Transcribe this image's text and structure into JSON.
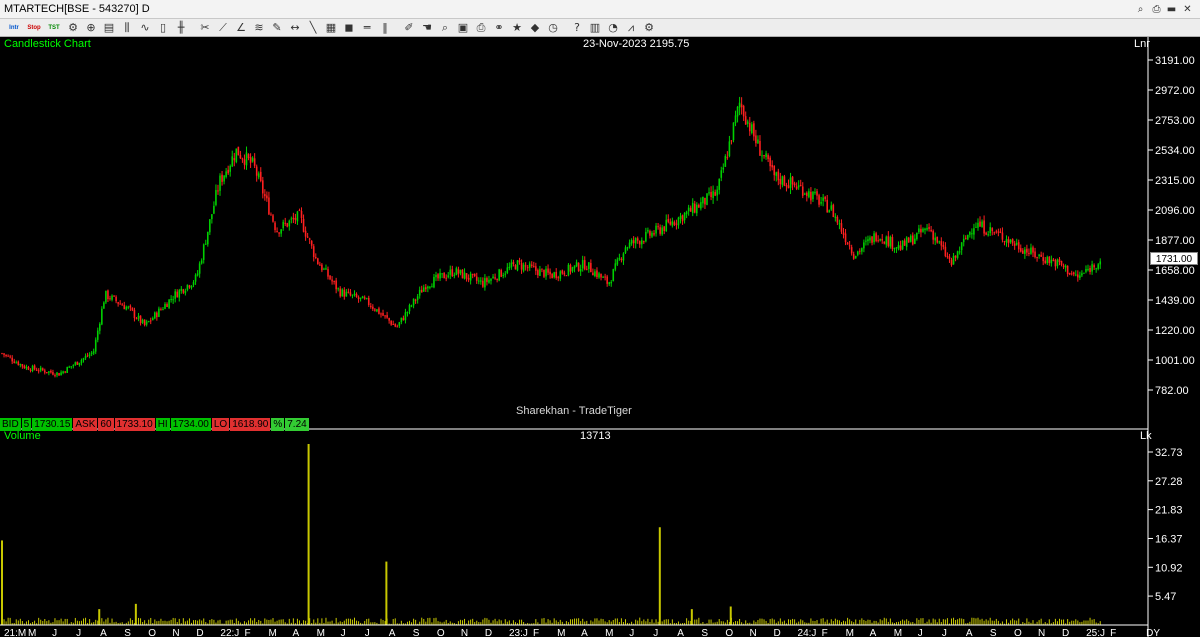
{
  "window": {
    "title": "MTARTECH[BSE - 543270] D"
  },
  "toolbar": {
    "items": [
      {
        "name": "intraday-icon",
        "glyph": "Intr"
      },
      {
        "name": "stop-icon",
        "glyph": "Stop"
      },
      {
        "name": "tst-icon",
        "glyph": "TST"
      },
      {
        "name": "settings-icon",
        "glyph": "⚙"
      },
      {
        "name": "crosshair-icon",
        "glyph": "⊕"
      },
      {
        "name": "chart-type-icon",
        "glyph": "▤"
      },
      {
        "name": "bars-icon",
        "glyph": "⫼"
      },
      {
        "name": "line-chart-icon",
        "glyph": "∿"
      },
      {
        "name": "candle-icon",
        "glyph": "▯"
      },
      {
        "name": "ohlc-icon",
        "glyph": "╫"
      },
      {
        "name": "scissors-icon",
        "glyph": "✂"
      },
      {
        "name": "trendline-icon",
        "glyph": "⟋"
      },
      {
        "name": "angle-icon",
        "glyph": "∠"
      },
      {
        "name": "fib-icon",
        "glyph": "≋"
      },
      {
        "name": "pencil-icon",
        "glyph": "✎"
      },
      {
        "name": "arrow-both-icon",
        "glyph": "↔"
      },
      {
        "name": "line-icon",
        "glyph": "╲"
      },
      {
        "name": "grid-icon",
        "glyph": "▦"
      },
      {
        "name": "cube-icon",
        "glyph": "◼"
      },
      {
        "name": "hline-icon",
        "glyph": "═"
      },
      {
        "name": "vlines-icon",
        "glyph": "‖"
      },
      {
        "name": "pen-icon",
        "glyph": "✐"
      },
      {
        "name": "hand-icon",
        "glyph": "☚"
      },
      {
        "name": "zoom-icon",
        "glyph": "⌕"
      },
      {
        "name": "document-icon",
        "glyph": "▣"
      },
      {
        "name": "print-icon",
        "glyph": "⎙"
      },
      {
        "name": "link-icon",
        "glyph": "⚭"
      },
      {
        "name": "star-icon",
        "glyph": "★"
      },
      {
        "name": "tag-icon",
        "glyph": "◆"
      },
      {
        "name": "clock-icon",
        "glyph": "◷"
      },
      {
        "name": "help-icon",
        "glyph": "?"
      },
      {
        "name": "trash-icon",
        "glyph": "▥"
      },
      {
        "name": "pie-icon",
        "glyph": "◔"
      },
      {
        "name": "graph-icon",
        "glyph": "⩘"
      },
      {
        "name": "gear-icon",
        "glyph": "⚙"
      }
    ]
  },
  "price_panel": {
    "label": "Candlestick Chart",
    "readout": "23-Nov-2023 2195.75",
    "scale": "Lnr",
    "watermark": "Sharekhan - TradeTiger",
    "last_price": "1731.00",
    "y_ticks": [
      "3191.00",
      "2972.00",
      "2753.00",
      "2534.00",
      "2315.00",
      "2096.00",
      "1877.00",
      "1658.00",
      "1439.00",
      "1220.00",
      "1001.00",
      "782.00"
    ]
  },
  "quote": {
    "bid_label": "BID",
    "bid_qty": "5",
    "bid": "1730.15",
    "ask_label": "ASK",
    "ask_qty": "60",
    "ask": "1733.10",
    "hi_label": "HI",
    "hi": "1734.00",
    "lo_label": "LO",
    "lo": "1618.90",
    "pct_label": "%",
    "pct": "7.24"
  },
  "volume_panel": {
    "label": "Volume",
    "readout": "13713",
    "unit": "Lk",
    "y_ticks": [
      "32.73",
      "27.28",
      "21.83",
      "16.37",
      "10.92",
      "5.47"
    ]
  },
  "x_axis": {
    "labels": [
      "21:M",
      "M",
      "J",
      "J",
      "A",
      "S",
      "O",
      "N",
      "D",
      "22:J",
      "F",
      "M",
      "A",
      "M",
      "J",
      "J",
      "A",
      "S",
      "O",
      "N",
      "D",
      "23:J",
      "F",
      "M",
      "A",
      "M",
      "J",
      "J",
      "A",
      "S",
      "O",
      "N",
      "D",
      "24:J",
      "F",
      "M",
      "A",
      "M",
      "J",
      "J",
      "A",
      "S",
      "O",
      "N",
      "D",
      "25:J",
      "F",
      "DY"
    ]
  },
  "colors": {
    "up": "#00d000",
    "down": "#ff2020",
    "volume": "#c8c800",
    "background": "#000000"
  },
  "chart_data": {
    "type": "candlestick",
    "symbol": "MTARTECH[BSE - 543270] D",
    "title": "Candlestick Chart",
    "ylim": [
      782,
      3191
    ],
    "volume_ylim": [
      0,
      32.73
    ],
    "anchor_closes": [
      {
        "t": 0.0,
        "v": 1050
      },
      {
        "t": 0.02,
        "v": 950
      },
      {
        "t": 0.05,
        "v": 900
      },
      {
        "t": 0.08,
        "v": 1060
      },
      {
        "t": 0.09,
        "v": 1480
      },
      {
        "t": 0.11,
        "v": 1380
      },
      {
        "t": 0.125,
        "v": 1250
      },
      {
        "t": 0.15,
        "v": 1470
      },
      {
        "t": 0.17,
        "v": 1600
      },
      {
        "t": 0.19,
        "v": 2300
      },
      {
        "t": 0.205,
        "v": 2530
      },
      {
        "t": 0.22,
        "v": 2420
      },
      {
        "t": 0.24,
        "v": 1950
      },
      {
        "t": 0.26,
        "v": 2050
      },
      {
        "t": 0.275,
        "v": 1730
      },
      {
        "t": 0.295,
        "v": 1500
      },
      {
        "t": 0.32,
        "v": 1420
      },
      {
        "t": 0.345,
        "v": 1240
      },
      {
        "t": 0.37,
        "v": 1550
      },
      {
        "t": 0.395,
        "v": 1650
      },
      {
        "t": 0.42,
        "v": 1560
      },
      {
        "t": 0.45,
        "v": 1700
      },
      {
        "t": 0.48,
        "v": 1620
      },
      {
        "t": 0.51,
        "v": 1700
      },
      {
        "t": 0.53,
        "v": 1560
      },
      {
        "t": 0.545,
        "v": 1830
      },
      {
        "t": 0.57,
        "v": 1930
      },
      {
        "t": 0.6,
        "v": 2080
      },
      {
        "t": 0.625,
        "v": 2220
      },
      {
        "t": 0.645,
        "v": 2880
      },
      {
        "t": 0.66,
        "v": 2580
      },
      {
        "t": 0.675,
        "v": 2340
      },
      {
        "t": 0.7,
        "v": 2250
      },
      {
        "t": 0.725,
        "v": 2100
      },
      {
        "t": 0.745,
        "v": 1770
      },
      {
        "t": 0.765,
        "v": 1920
      },
      {
        "t": 0.785,
        "v": 1820
      },
      {
        "t": 0.81,
        "v": 1970
      },
      {
        "t": 0.83,
        "v": 1700
      },
      {
        "t": 0.85,
        "v": 2000
      },
      {
        "t": 0.875,
        "v": 1900
      },
      {
        "t": 0.9,
        "v": 1780
      },
      {
        "t": 0.925,
        "v": 1700
      },
      {
        "t": 0.94,
        "v": 1600
      },
      {
        "t": 0.96,
        "v": 1731
      }
    ],
    "volume_spikes": [
      {
        "t": 0.0,
        "v": 16.0
      },
      {
        "t": 0.117,
        "v": 4.0
      },
      {
        "t": 0.268,
        "v": 35.0
      },
      {
        "t": 0.336,
        "v": 12.0
      },
      {
        "t": 0.575,
        "v": 18.5
      },
      {
        "t": 0.603,
        "v": 3.0
      },
      {
        "t": 0.637,
        "v": 3.5
      },
      {
        "t": 0.085,
        "v": 3.0
      }
    ]
  }
}
